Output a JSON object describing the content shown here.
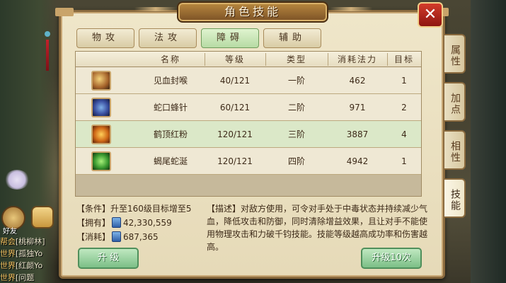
{
  "window": {
    "title": "角色技能",
    "close_icon": "✕"
  },
  "tabs": [
    {
      "label": "物攻",
      "active": false
    },
    {
      "label": "法攻",
      "active": false
    },
    {
      "label": "障碍",
      "active": true
    },
    {
      "label": "辅助",
      "active": false
    }
  ],
  "side_tabs": [
    {
      "label": "属性",
      "active": false
    },
    {
      "label": "加点",
      "active": false
    },
    {
      "label": "相性",
      "active": false
    },
    {
      "label": "技能",
      "active": true
    }
  ],
  "table": {
    "headers": [
      "名称",
      "等级",
      "类型",
      "消耗法力",
      "目标"
    ],
    "rows": [
      {
        "icon": "blood-seal-icon",
        "name": "见血封喉",
        "level": "40/121",
        "type": "一阶",
        "mana": "462",
        "target": "1",
        "selected": false
      },
      {
        "icon": "snake-needle-icon",
        "name": "蛇口蜂针",
        "level": "60/121",
        "type": "二阶",
        "mana": "971",
        "target": "2",
        "selected": false
      },
      {
        "icon": "crane-powder-icon",
        "name": "鹤顶红粉",
        "level": "120/121",
        "type": "三阶",
        "mana": "3887",
        "target": "4",
        "selected": true
      },
      {
        "icon": "scorpion-tail-icon",
        "name": "蝎尾蛇涎",
        "level": "120/121",
        "type": "四阶",
        "mana": "4942",
        "target": "1",
        "selected": false
      }
    ]
  },
  "info": {
    "condition": "【条件】升至160级目标增至5",
    "owned_label": "【拥有】",
    "owned_value": "42,330,559",
    "cost_label": "【消耗】",
    "cost_value": "687,365",
    "description": "【描述】对敌方使用，可令对手处于中毒状态并持续减少气血，降低攻击和防御，同时清除增益效果，且让对手不能使用物理攻击和力破千钧技能。技能等级越高成功率和伤害越高。"
  },
  "buttons": {
    "upgrade": "升 级",
    "upgrade_ten": "升级10次"
  },
  "hud": {
    "friend_label": "好友",
    "chat_lines": [
      {
        "tag": "帮会",
        "text": "[桃柳林]"
      },
      {
        "tag": "世界",
        "text": "[孤独Yo"
      },
      {
        "tag": "世界",
        "text": "[红颜Yo"
      },
      {
        "tag": "世界",
        "text": "[问题"
      }
    ]
  },
  "colors": {
    "panel_bg": "#efe6c9",
    "panel_border": "#8a6a3e",
    "selected_row": "#dbe8c8",
    "active_tab": "#b7dba4",
    "green_button": "#7cbf87",
    "close_button": "#d33c2a"
  }
}
